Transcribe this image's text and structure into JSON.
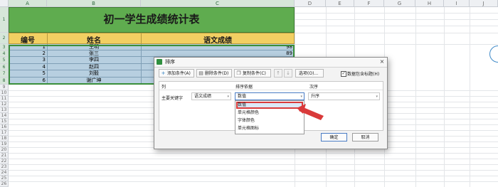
{
  "spreadsheet": {
    "columns": [
      "A",
      "B",
      "C",
      "D",
      "E",
      "F",
      "G",
      "H",
      "I",
      "J"
    ],
    "row_numbers": [
      "1",
      "2",
      "3",
      "4",
      "5",
      "6",
      "7",
      "8",
      "9",
      "10",
      "11",
      "12",
      "13",
      "14",
      "15",
      "16",
      "17",
      "18",
      "19",
      "20",
      "21",
      "22",
      "23",
      "24",
      "25",
      "26"
    ],
    "title": "初一学生成绩统计表",
    "headers": [
      "编号",
      "姓名",
      "语文成绩"
    ],
    "rows": [
      {
        "id": "1",
        "name": "王明",
        "score": "98"
      },
      {
        "id": "2",
        "name": "张三",
        "score": "89"
      },
      {
        "id": "3",
        "name": "李四",
        "score": ""
      },
      {
        "id": "4",
        "name": "赵四",
        "score": ""
      },
      {
        "id": "5",
        "name": "刘毅",
        "score": ""
      },
      {
        "id": "6",
        "name": "谢广坤",
        "score": ""
      }
    ]
  },
  "dialog": {
    "title": "排序",
    "close": "×",
    "toolbar": {
      "add": "添加条件(A)",
      "delete": "删除条件(D)",
      "copy": "复制条件(C)",
      "up": "↑",
      "down": "↓",
      "options": "选项(O)...",
      "has_header": "数据包含标题(H)",
      "has_header_checked": "✓"
    },
    "columns_header": {
      "column": "列",
      "sort_on": "排序依据",
      "order": "次序"
    },
    "row": {
      "key_label": "主要关键字",
      "column_value": "语文成绩",
      "sort_on_value": "数值",
      "order_value": "升序"
    },
    "dropdown_options": [
      "数值",
      "单元格颜色",
      "字体颜色",
      "单元格图标"
    ],
    "ok": "确定",
    "cancel": "取消"
  },
  "colors": {
    "title_band": "#5fac4f",
    "header_band": "#f2cf62",
    "data_rows": "#b7cfe0",
    "highlight": "#d93a3a"
  }
}
